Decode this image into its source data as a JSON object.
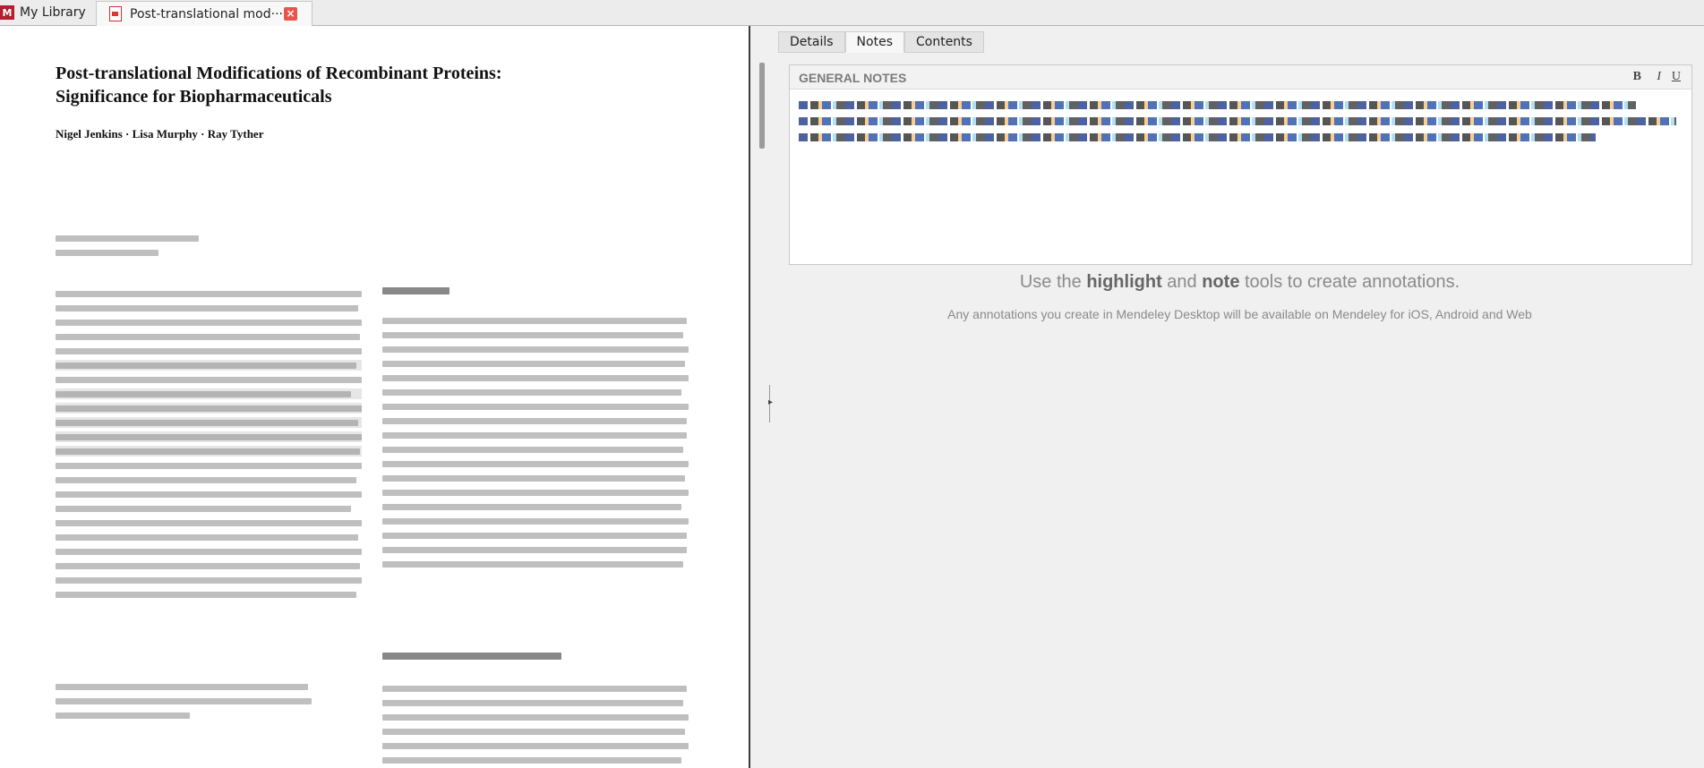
{
  "tabs": {
    "library_label": "My Library",
    "document_label": "Post-translational mod···"
  },
  "pdf": {
    "title_line1": "Post-translational Modifications of Recombinant Proteins:",
    "title_line2": "Significance for Biopharmaceuticals",
    "authors": "Nigel Jenkins · Lisa Murphy · Ray Tyther"
  },
  "side_tabs": [
    "Details",
    "Notes",
    "Contents"
  ],
  "notes": {
    "header": "GENERAL NOTES",
    "bold": "B",
    "italic": "I",
    "underline": "U"
  },
  "hints": {
    "part1": "Use the ",
    "highlight": "highlight",
    "part2": " and ",
    "note": "note",
    "part3": " tools to create annotations.",
    "sub": "Any annotations you create in Mendeley Desktop will be available on Mendeley for iOS, Android and Web"
  },
  "colors": {
    "accent": "#b21f2d",
    "close": "#e7564d"
  }
}
